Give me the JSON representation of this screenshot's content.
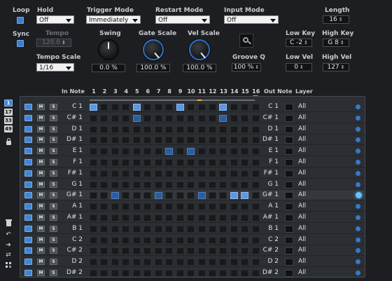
{
  "top": {
    "loop": {
      "label": "Loop",
      "checked": true
    },
    "sync": {
      "label": "Sync",
      "checked": true
    },
    "hold": {
      "label": "Hold",
      "value": "Off"
    },
    "tempo": {
      "label": "Tempo",
      "value": "120.0"
    },
    "tempo_scale": {
      "label": "Tempo Scale",
      "value": "1/16"
    },
    "trigger_mode": {
      "label": "Trigger Mode",
      "value": "Immediately"
    },
    "restart_mode": {
      "label": "Restart Mode",
      "value": "Off"
    },
    "input_mode": {
      "label": "Input Mode",
      "value": "Off"
    },
    "length": {
      "label": "Length",
      "value": "16"
    },
    "swing": {
      "label": "Swing",
      "value": "0.0 %"
    },
    "gate_scale": {
      "label": "Gate Scale",
      "value": "100.0 %"
    },
    "vel_scale": {
      "label": "Vel Scale",
      "value": "100.0 %"
    },
    "groove_q": {
      "label": "Groove Q",
      "value": "100 %"
    },
    "low_key": {
      "label": "Low Key",
      "value": "C -2"
    },
    "high_key": {
      "label": "High Key",
      "value": "G 8"
    },
    "low_vel": {
      "label": "Low Vel",
      "value": "0"
    },
    "high_vel": {
      "label": "High Vel",
      "value": "127"
    }
  },
  "grid": {
    "in_note_header": "In Note",
    "out_note_header": "Out Note",
    "layer_header": "Layer",
    "steps": [
      "1",
      "2",
      "3",
      "4",
      "5",
      "6",
      "7",
      "8",
      "9",
      "10",
      "11",
      "12",
      "13",
      "14",
      "15",
      "16"
    ],
    "m_label": "M",
    "s_label": "S",
    "rows": [
      {
        "in": "C 1",
        "out": "C 1",
        "layer": "All",
        "active": [
          1,
          5,
          9,
          13
        ],
        "dim": []
      },
      {
        "in": "C# 1",
        "out": "C# 1",
        "layer": "All",
        "active": [],
        "dim": [
          5,
          13
        ]
      },
      {
        "in": "D 1",
        "out": "D 1",
        "layer": "All",
        "active": [],
        "dim": []
      },
      {
        "in": "D# 1",
        "out": "D# 1",
        "layer": "All",
        "active": [],
        "dim": []
      },
      {
        "in": "E 1",
        "out": "E 1",
        "layer": "All",
        "active": [],
        "dim": [
          8,
          10
        ]
      },
      {
        "in": "F 1",
        "out": "F 1",
        "layer": "All",
        "active": [],
        "dim": []
      },
      {
        "in": "F# 1",
        "out": "F# 1",
        "layer": "All",
        "active": [],
        "dim": []
      },
      {
        "in": "G 1",
        "out": "G 1",
        "layer": "All",
        "active": [],
        "dim": []
      },
      {
        "in": "G# 1",
        "out": "G# 1",
        "layer": "All",
        "active": [
          14,
          15
        ],
        "dim": [
          3,
          7,
          11
        ]
      },
      {
        "in": "A 1",
        "out": "A 1",
        "layer": "All",
        "active": [],
        "dim": []
      },
      {
        "in": "A# 1",
        "out": "A# 1",
        "layer": "All",
        "active": [],
        "dim": []
      },
      {
        "in": "B 1",
        "out": "B 1",
        "layer": "All",
        "active": [],
        "dim": []
      },
      {
        "in": "C 2",
        "out": "C 2",
        "layer": "All",
        "active": [],
        "dim": []
      },
      {
        "in": "C# 2",
        "out": "C# 2",
        "layer": "All",
        "active": [],
        "dim": []
      },
      {
        "in": "D 2",
        "out": "D 2",
        "layer": "All",
        "active": [],
        "dim": []
      },
      {
        "in": "D# 2",
        "out": "D# 2",
        "layer": "All",
        "active": [],
        "dim": []
      }
    ],
    "highlighted_row": 8
  },
  "octave_buttons": [
    "1",
    "17",
    "33",
    "49"
  ],
  "colors": {
    "accent": "#3f86d8",
    "active_step": "#5b98e2",
    "background": "#1c1e21"
  }
}
